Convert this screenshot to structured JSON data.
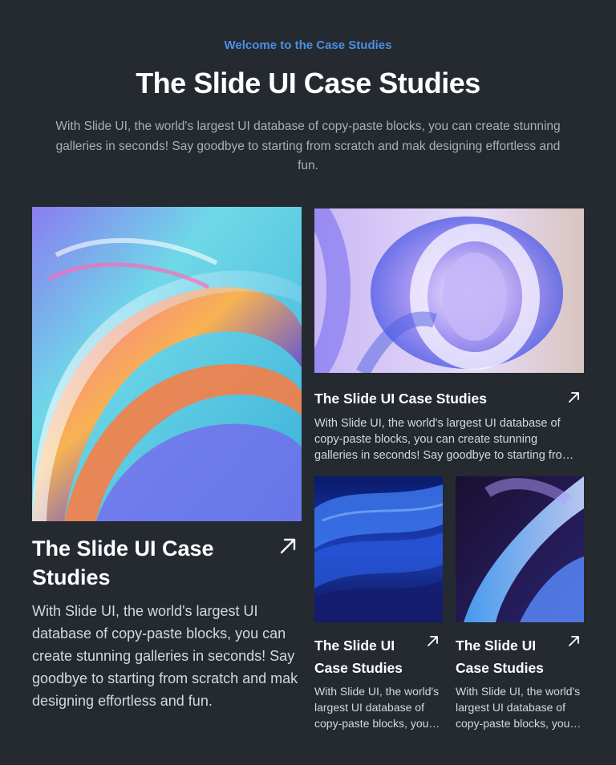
{
  "header": {
    "eyebrow": "Welcome to the Case Studies",
    "title": "The Slide UI Case Studies",
    "subtitle": "With Slide UI, the world's largest UI database of copy-paste blocks, you can create stunning galleries in seconds! Say goodbye to starting from scratch and mak designing effortless and fun."
  },
  "cards": [
    {
      "title": "The Slide UI Case Studies",
      "description": "With Slide UI, the world's largest UI database of copy-paste blocks, you can create stunning galleries in seconds! Say goodbye to starting from scratch and mak designing effortless and fun.",
      "arrow_icon": "arrow-up-right-icon"
    },
    {
      "title": "The Slide UI Case Studies",
      "description": "With Slide UI, the world's largest UI database of copy-paste blocks, you can create stunning galleries in seconds! Say goodbye to starting from scratch and mak designing effortless and fun.",
      "arrow_icon": "arrow-up-right-icon"
    },
    {
      "title": "The Slide UI Case Studies",
      "description": "With Slide UI, the world's largest UI database of copy-paste blocks, you can create stunning galleries in seconds! Say goodbye to starting from scratch and mak designing effortless and fun.",
      "arrow_icon": "arrow-up-right-icon"
    },
    {
      "title": "The Slide UI Case Studies",
      "description": "With Slide UI, the world's largest UI database of copy-paste blocks, you can create stunning galleries in seconds! Say goodbye to starting from scratch and mak designing effortless and fun.",
      "arrow_icon": "arrow-up-right-icon"
    }
  ],
  "colors": {
    "background": "#252a31",
    "accent": "#4a90e2",
    "text_muted": "#a9b0ba"
  }
}
